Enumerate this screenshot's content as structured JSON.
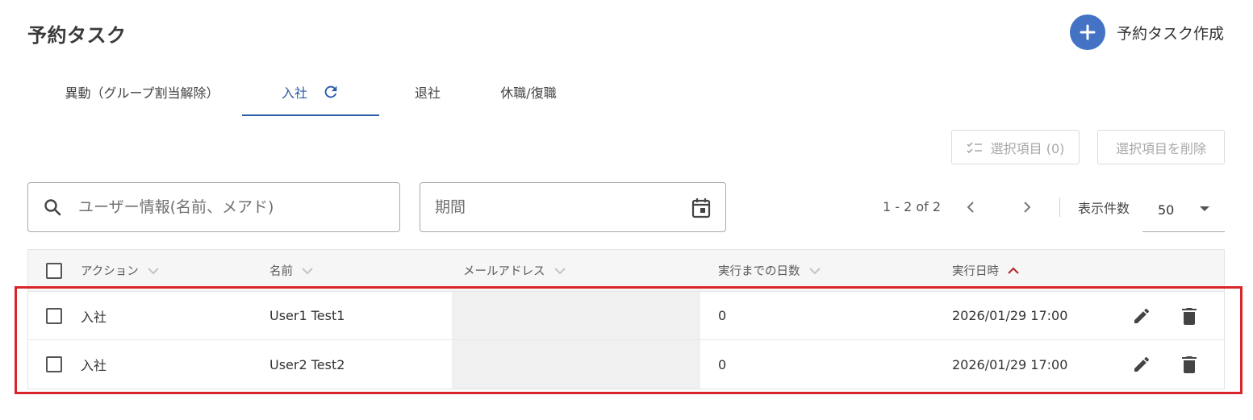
{
  "page": {
    "title": "予約タスク"
  },
  "create_button": {
    "label": "予約タスク作成",
    "icon": "plus-icon",
    "color": "#4472c4"
  },
  "tabs": [
    {
      "label": "異動（グループ割当解除）",
      "active": false
    },
    {
      "label": "入社",
      "active": true,
      "icon": "refresh-icon"
    },
    {
      "label": "退社",
      "active": false
    },
    {
      "label": "休職/復職",
      "active": false
    }
  ],
  "bulk_actions": {
    "selected_label": "選択項目 (0)",
    "delete_label": "選択項目を削除"
  },
  "filters": {
    "search": {
      "placeholder": "ユーザー情報(名前、メアド)",
      "value": ""
    },
    "period": {
      "placeholder": "期間",
      "value": ""
    }
  },
  "pagination": {
    "range": "1 - 2 of 2",
    "rows_label": "表示件数",
    "rows_per_page": "50"
  },
  "table": {
    "columns": [
      "アクション",
      "名前",
      "メールアドレス",
      "実行までの日数",
      "実行日時"
    ],
    "sorted_column": "実行日時",
    "rows": [
      {
        "action": "入社",
        "name": "User1 Test1",
        "email": "",
        "days": "0",
        "datetime": "2026/01/29 17:00"
      },
      {
        "action": "入社",
        "name": "User2 Test2",
        "email": "",
        "days": "0",
        "datetime": "2026/01/29 17:00"
      }
    ]
  },
  "colors": {
    "accent": "#2a5ba8",
    "highlight": "#d9262c",
    "sort_arrow": "#b03030"
  }
}
